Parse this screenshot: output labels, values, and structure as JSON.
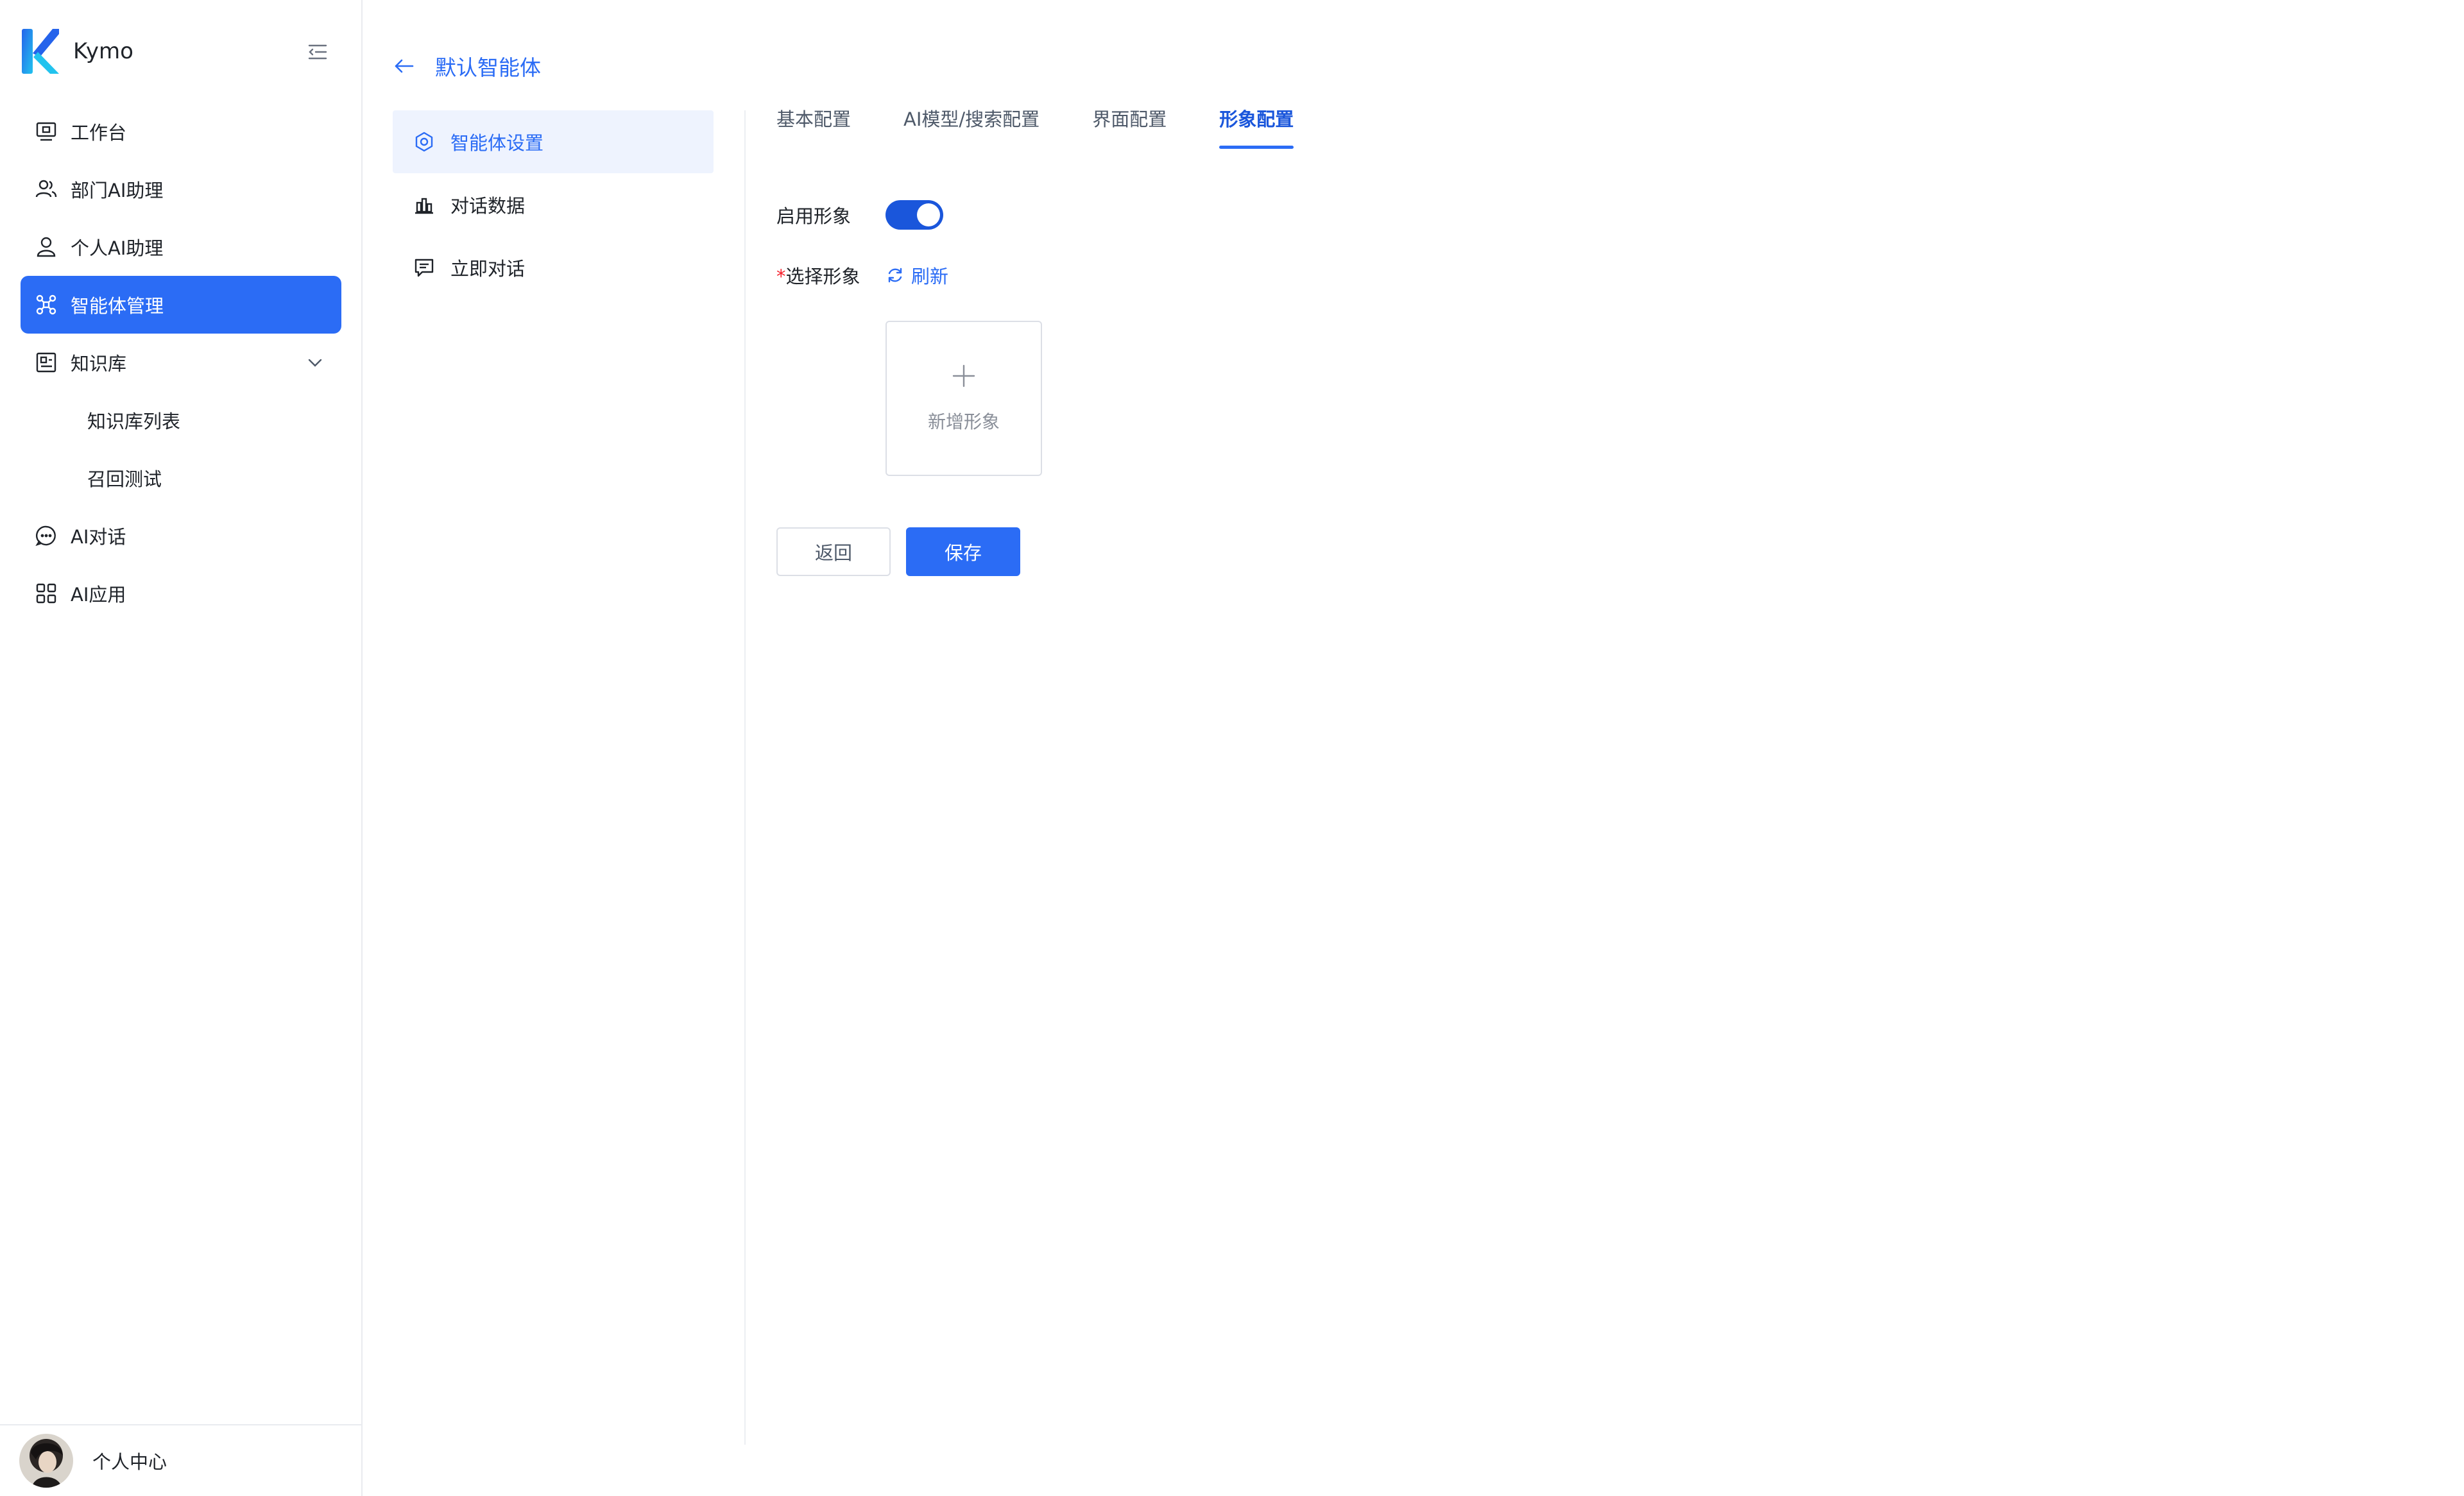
{
  "app": {
    "name": "Kymo",
    "brand_color": "#2b6cf5"
  },
  "sidebar": {
    "items": [
      {
        "label": "工作台",
        "icon": "monitor-icon"
      },
      {
        "label": "部门AI助理",
        "icon": "users-icon"
      },
      {
        "label": "个人AI助理",
        "icon": "user-icon"
      },
      {
        "label": "智能体管理",
        "icon": "agent-icon",
        "active": true
      },
      {
        "label": "知识库",
        "icon": "knowledge-icon",
        "expanded": true
      },
      {
        "label": "知识库列表"
      },
      {
        "label": "召回测试"
      },
      {
        "label": "AI对话",
        "icon": "chat-icon"
      },
      {
        "label": "AI应用",
        "icon": "grid-icon"
      }
    ],
    "footer_label": "个人中心"
  },
  "header": {
    "title": "默认智能体"
  },
  "sub_menu": {
    "items": [
      {
        "label": "智能体设置",
        "icon": "settings-icon",
        "active": true
      },
      {
        "label": "对话数据",
        "icon": "bar-chart-icon"
      },
      {
        "label": "立即对话",
        "icon": "message-icon"
      }
    ]
  },
  "tabs": [
    {
      "label": "基本配置"
    },
    {
      "label": "AI模型/搜索配置"
    },
    {
      "label": "界面配置"
    },
    {
      "label": "形象配置",
      "active": true
    }
  ],
  "form": {
    "enable_label": "启用形象",
    "enable_value": true,
    "select_required_mark": "*",
    "select_label": "选择形象",
    "refresh_label": "刷新",
    "add_label": "新增形象"
  },
  "buttons": {
    "back_label": "返回",
    "save_label": "保存"
  }
}
